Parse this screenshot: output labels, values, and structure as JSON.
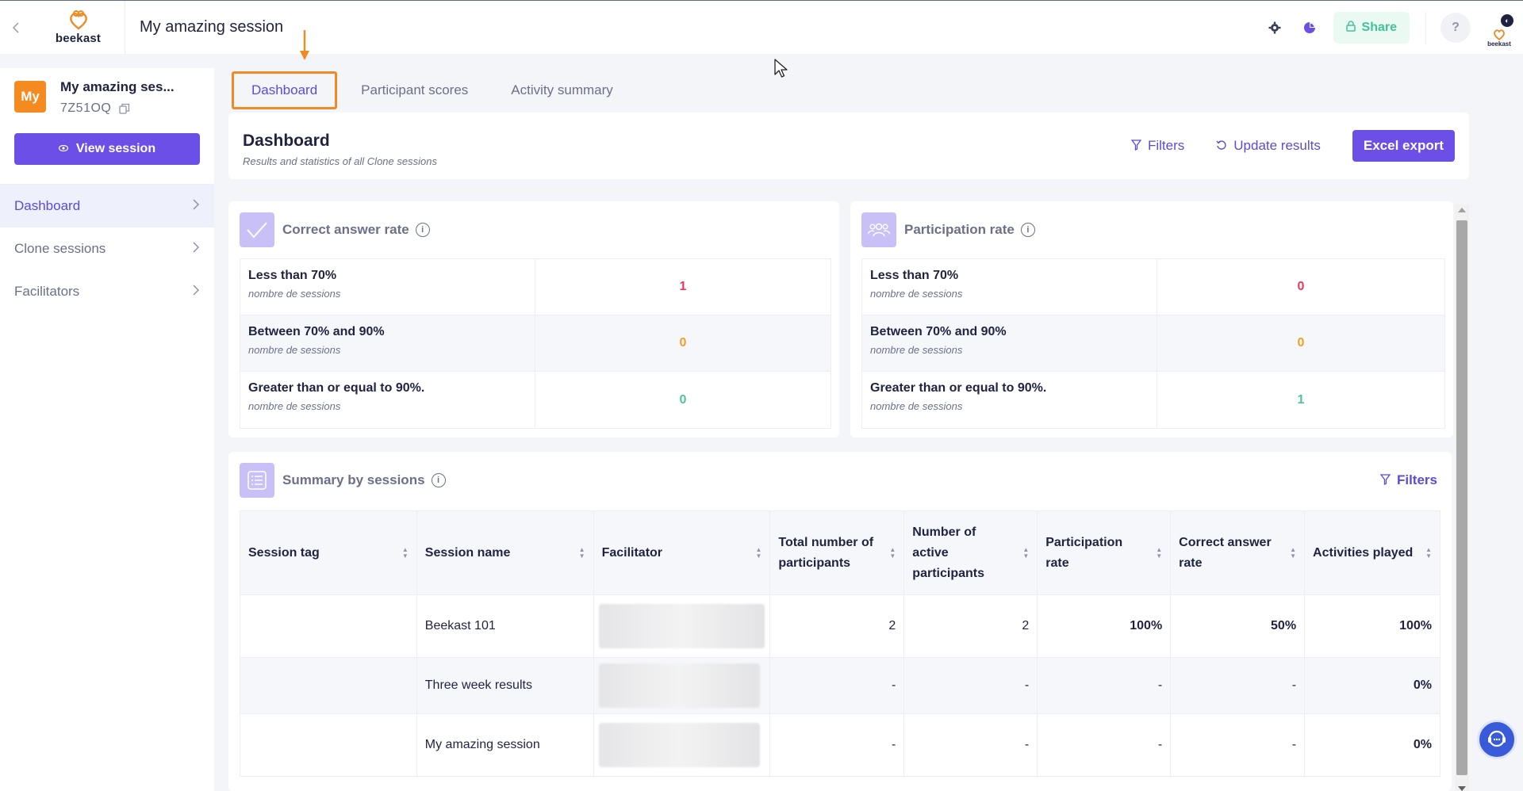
{
  "topbar": {
    "brand": "beekast",
    "session_title": "My amazing session",
    "share_label": "Share",
    "help_label": "?",
    "user_mini_logo": "beekast",
    "icons": [
      "back-chevron-icon",
      "gear-icon",
      "pie-chart-icon",
      "lock-icon",
      "help-icon"
    ]
  },
  "sidebar": {
    "avatar_initials": "My",
    "session_name": "My amazing ses...",
    "session_code": "7Z51OQ",
    "view_session_label": "View session",
    "items": [
      {
        "label": "Dashboard",
        "active": true
      },
      {
        "label": "Clone sessions",
        "active": false
      },
      {
        "label": "Facilitators",
        "active": false
      }
    ]
  },
  "tabs": [
    {
      "label": "Dashboard",
      "active": true
    },
    {
      "label": "Participant scores",
      "active": false
    },
    {
      "label": "Activity summary",
      "active": false
    }
  ],
  "dashboard": {
    "title": "Dashboard",
    "subtitle": "Results and statistics of all Clone sessions",
    "filters_label": "Filters",
    "update_label": "Update results",
    "export_label": "Excel export"
  },
  "correct_answer": {
    "title": "Correct answer rate",
    "rows": [
      {
        "label": "Less than 70%",
        "sub": "nombre de sessions",
        "value": "1"
      },
      {
        "label": "Between 70% and 90%",
        "sub": "nombre de sessions",
        "value": "0"
      },
      {
        "label": "Greater than or equal to 90%.",
        "sub": "nombre de sessions",
        "value": "0"
      }
    ]
  },
  "participation": {
    "title": "Participation rate",
    "rows": [
      {
        "label": "Less than 70%",
        "sub": "nombre de sessions",
        "value": "0"
      },
      {
        "label": "Between 70% and 90%",
        "sub": "nombre de sessions",
        "value": "0"
      },
      {
        "label": "Greater than or equal to 90%.",
        "sub": "nombre de sessions",
        "value": "1"
      }
    ]
  },
  "summary": {
    "title": "Summary by sessions",
    "filters_label": "Filters",
    "columns": [
      "Session tag",
      "Session name",
      "Facilitator",
      "Total number of participants",
      "Number of active participants",
      "Participation rate",
      "Correct answer rate",
      "Activities played"
    ],
    "rows": [
      {
        "tag": "",
        "name": "Beekast 101",
        "total": "2",
        "active": "2",
        "participation": "100%",
        "correct": "50%",
        "activities": "100%"
      },
      {
        "tag": "",
        "name": "Three week results",
        "total": "-",
        "active": "-",
        "participation": "-",
        "correct": "-",
        "activities": "0%"
      },
      {
        "tag": "",
        "name": "My amazing session",
        "total": "-",
        "active": "-",
        "participation": "-",
        "correct": "-",
        "activities": "0%"
      }
    ]
  },
  "colors": {
    "primary": "#6b4fe6",
    "accent_orange": "#f08a24",
    "red": "#e8395a",
    "orange": "#f0a026",
    "green": "#4cc59a"
  }
}
